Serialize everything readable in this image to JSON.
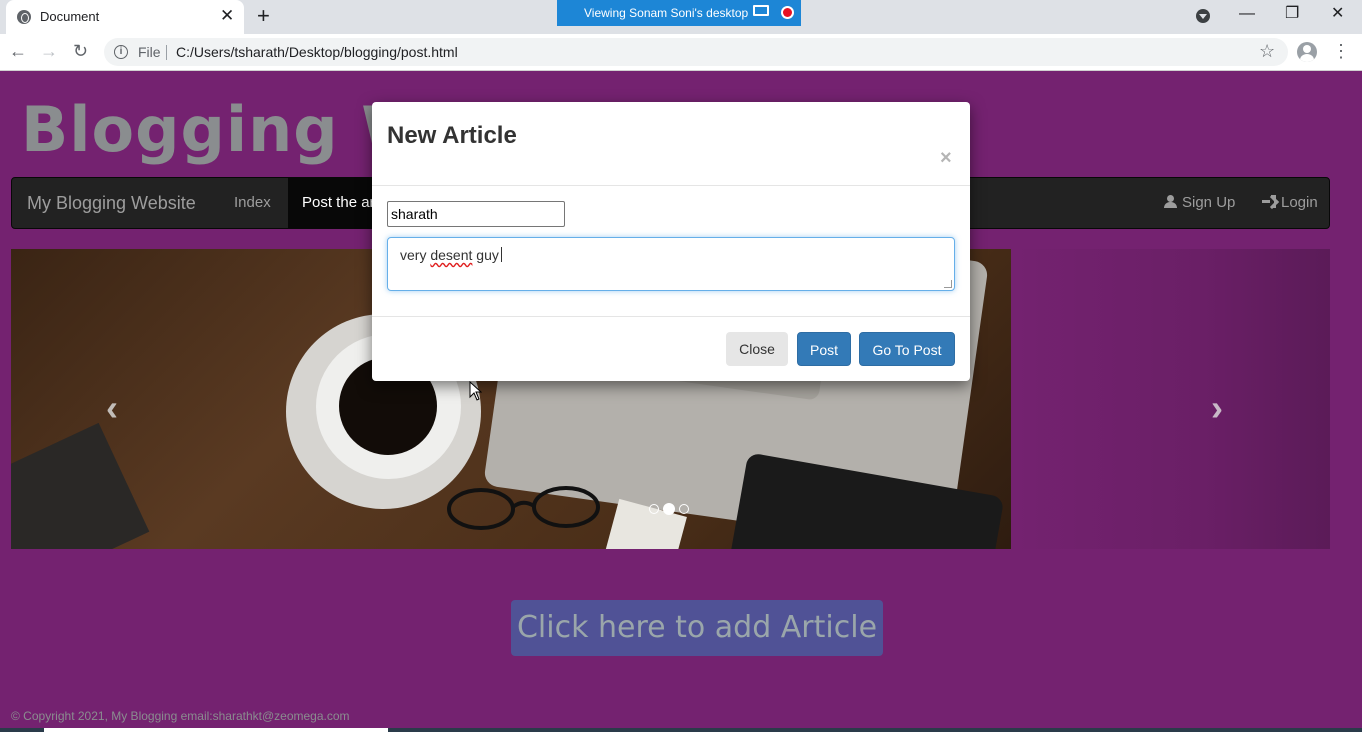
{
  "browser": {
    "tab_title": "Document",
    "new_tab_symbol": "+",
    "close_symbol": "✕",
    "viewing_banner": "Viewing Sonam Soni's desktop",
    "file_label": "File",
    "url": "C:/Users/tsharath/Desktop/blogging/post.html",
    "window_controls": {
      "minimize": "—",
      "restore": "❐",
      "close": "✕"
    },
    "nav": {
      "back": "←",
      "forward": "→",
      "reload": "↻",
      "star": "☆",
      "menu": "⋮"
    }
  },
  "site": {
    "header": "Blogging Website",
    "navbar": {
      "brand": "My Blogging Website",
      "items": [
        "Index",
        "Post the article"
      ],
      "right": [
        "Sign Up",
        "Login"
      ]
    },
    "carousel": {
      "prev": "‹",
      "next": "›",
      "slides": 3,
      "active_slide": 2
    },
    "add_article_button": "Click here to add Article",
    "footer": "© Copyright 2021, My Blogging email:sharathkt@zeomega.com"
  },
  "modal": {
    "title": "New Article",
    "close_symbol": "×",
    "name_value": "sharath",
    "article_text_before": "very ",
    "article_text_misspelled": "desent",
    "article_text_after": " guy",
    "buttons": {
      "close": "Close",
      "post": "Post",
      "go_to_post": "Go To Post"
    }
  },
  "colors": {
    "page_bg": "#742270",
    "navbar_bg": "#222222",
    "primary": "#337ab7",
    "banner_blue": "#1d86d6"
  }
}
